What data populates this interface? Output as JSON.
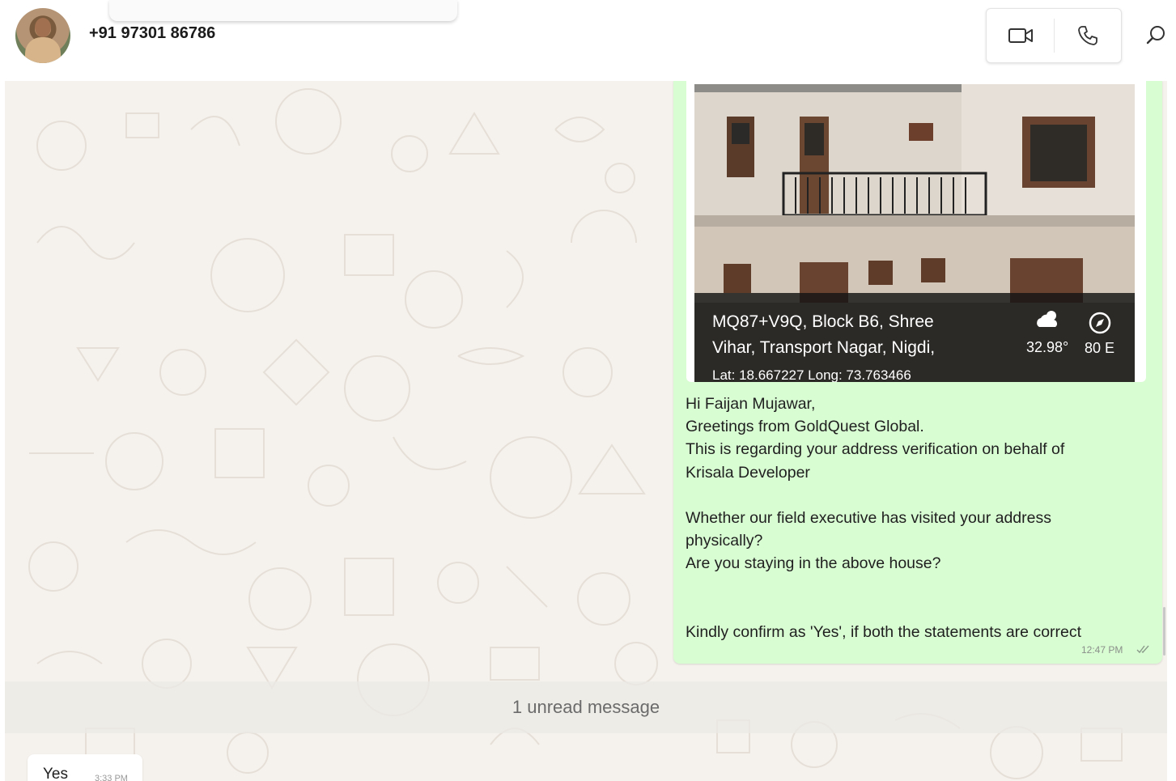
{
  "header": {
    "contact_name": "+91 97301 86786",
    "icons": {
      "video": "video-camera-icon",
      "voice": "phone-icon",
      "search": "search-icon"
    }
  },
  "messages": {
    "outgoing": {
      "photo_caption": {
        "address_line_1": "MQ87+V9Q, Block B6, Shree",
        "address_line_2": "Vihar, Transport Nagar, Nigdi,",
        "lat_long": "Lat: 18.667227 Long: 73.763466",
        "temperature": "32.98°",
        "heading": "80 E"
      },
      "lines": [
        "Hi Faijan Mujawar,",
        "Greetings from GoldQuest Global.",
        "This is regarding your address verification on behalf of",
        "Krisala Developer",
        "Whether our field executive has visited your address",
        "physically?",
        "Are you staying in the above house?",
        "Kindly confirm as 'Yes', if both the statements are correct"
      ],
      "time": "12:47 PM"
    },
    "unread_divider": "1 unread message",
    "incoming": {
      "text": "Yes",
      "time": "3:33 PM"
    }
  },
  "colors": {
    "outgoing_bubble": "#d9fdd3",
    "chat_background": "#f5f1ec",
    "header_background": "#ffffff"
  }
}
